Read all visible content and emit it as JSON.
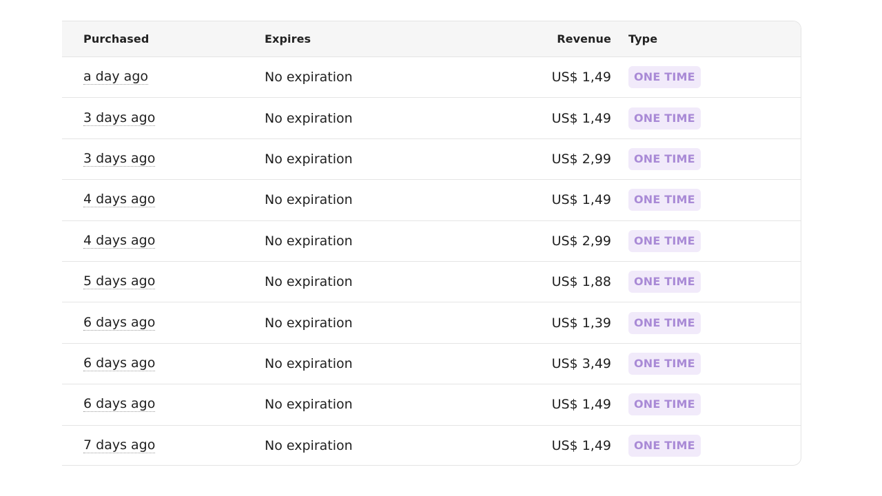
{
  "table": {
    "columns": {
      "purchased": "Purchased",
      "expires": "Expires",
      "revenue": "Revenue",
      "type": "Type"
    },
    "rows": [
      {
        "purchased": "a day ago",
        "expires": "No expiration",
        "revenue": "US$ 1,49",
        "type": "ONE TIME"
      },
      {
        "purchased": "3 days ago",
        "expires": "No expiration",
        "revenue": "US$ 1,49",
        "type": "ONE TIME"
      },
      {
        "purchased": "3 days ago",
        "expires": "No expiration",
        "revenue": "US$ 2,99",
        "type": "ONE TIME"
      },
      {
        "purchased": "4 days ago",
        "expires": "No expiration",
        "revenue": "US$ 1,49",
        "type": "ONE TIME"
      },
      {
        "purchased": "4 days ago",
        "expires": "No expiration",
        "revenue": "US$ 2,99",
        "type": "ONE TIME"
      },
      {
        "purchased": "5 days ago",
        "expires": "No expiration",
        "revenue": "US$ 1,88",
        "type": "ONE TIME"
      },
      {
        "purchased": "6 days ago",
        "expires": "No expiration",
        "revenue": "US$ 1,39",
        "type": "ONE TIME"
      },
      {
        "purchased": "6 days ago",
        "expires": "No expiration",
        "revenue": "US$ 3,49",
        "type": "ONE TIME"
      },
      {
        "purchased": "6 days ago",
        "expires": "No expiration",
        "revenue": "US$ 1,49",
        "type": "ONE TIME"
      },
      {
        "purchased": "7 days ago",
        "expires": "No expiration",
        "revenue": "US$ 1,49",
        "type": "ONE TIME"
      }
    ]
  },
  "colors": {
    "badge_bg": "#f1eafa",
    "badge_text": "#a98ad6",
    "header_bg": "#f6f6f6",
    "border": "#e4e4e4"
  }
}
